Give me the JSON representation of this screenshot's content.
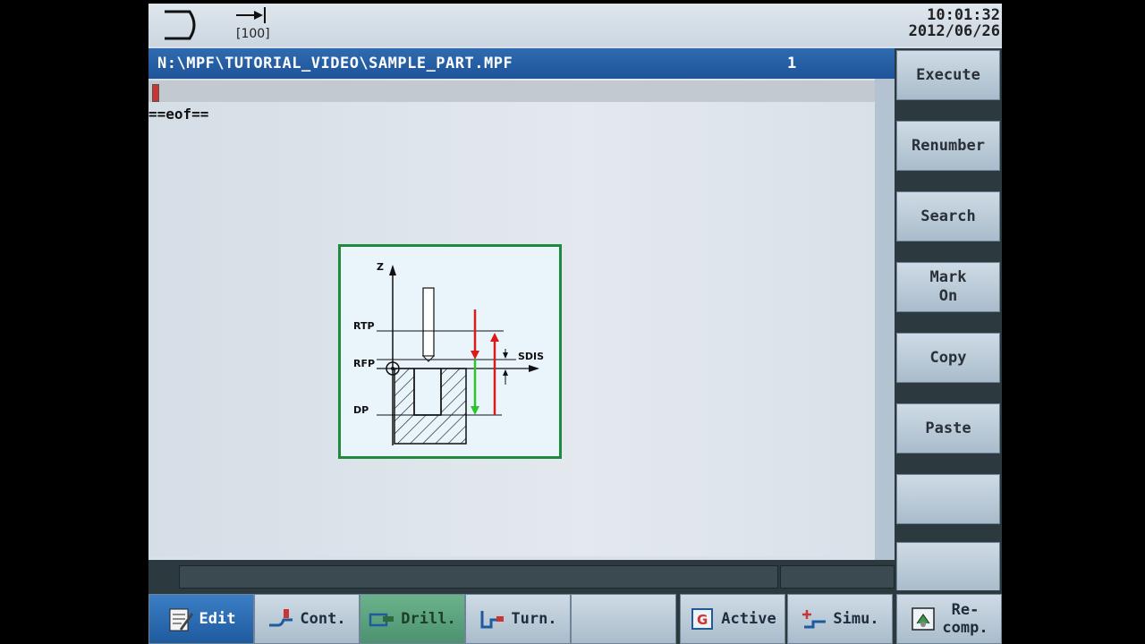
{
  "header": {
    "feed_label": "[100]",
    "time": "10:01:32",
    "date": "2012/06/26"
  },
  "path_bar": {
    "path": "N:\\MPF\\TUTORIAL_VIDEO\\SAMPLE_PART.MPF",
    "channel": "1"
  },
  "editor": {
    "eof": "==eof=="
  },
  "help_figure": {
    "z": "Z",
    "rtp": "RTP",
    "rfp": "RFP",
    "dp": "DP",
    "sdis": "SDIS"
  },
  "vertical_softkeys": [
    {
      "label": "Execute"
    },
    {
      "label": "Renumber"
    },
    {
      "label": "Search"
    },
    {
      "label": "Mark\nOn"
    },
    {
      "label": "Copy"
    },
    {
      "label": "Paste"
    },
    {
      "label": ""
    },
    {
      "label": ""
    }
  ],
  "horizontal_softkeys": [
    {
      "label": "Edit",
      "icon": "edit-icon",
      "state": "active"
    },
    {
      "label": "Cont.",
      "icon": "contour-icon",
      "state": "normal"
    },
    {
      "label": "Drill.",
      "icon": "drill-icon",
      "state": "pressed"
    },
    {
      "label": "Turn.",
      "icon": "turn-icon",
      "state": "normal"
    },
    {
      "label": "",
      "icon": "",
      "state": "normal"
    },
    {
      "label": "Active",
      "icon": "g-code-icon",
      "state": "normal"
    },
    {
      "label": "Simu.",
      "icon": "simulation-icon",
      "state": "normal"
    },
    {
      "label": "Re-\ncomp.",
      "icon": "recompile-icon",
      "state": "normal"
    }
  ],
  "colors": {
    "accent_blue": "#1e5399",
    "frame_green": "#1d8a3e",
    "rapid_red": "#d81b1b",
    "feed_green": "#2fc42f"
  }
}
